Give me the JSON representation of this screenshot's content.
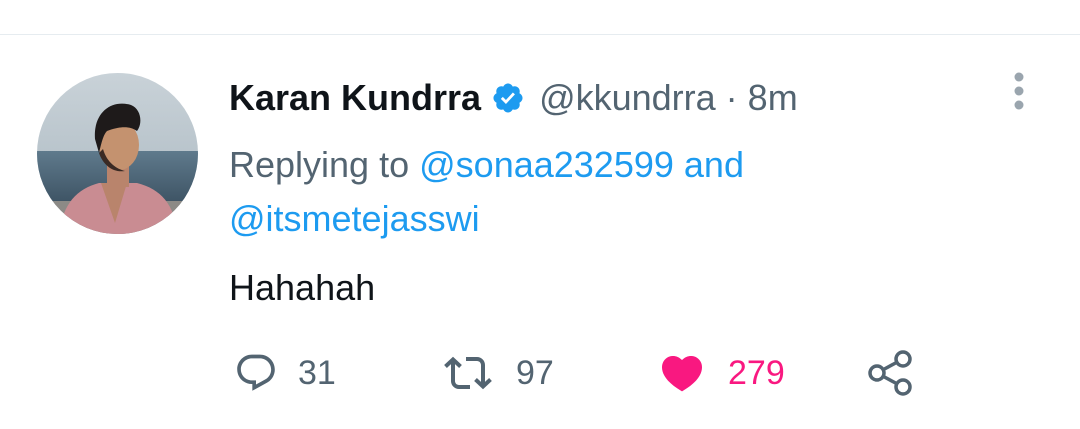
{
  "tweet": {
    "author_name": "Karan Kundrra",
    "verified": true,
    "handle": "@kkundrra",
    "separator": "·",
    "time": "8m",
    "reply_prefix": "Replying to",
    "reply_mention_1": "@sonaa232599",
    "reply_conjunction": "and",
    "reply_mention_2": "@itsmetejasswi",
    "text": "Hahahah"
  },
  "actions": {
    "replies": "31",
    "retweets": "97",
    "likes": "279",
    "liked": true
  },
  "icons": {
    "reply": "reply-icon",
    "retweet": "retweet-icon",
    "like": "heart-icon",
    "share": "share-icon",
    "more": "more-vertical-icon",
    "verified": "verified-badge-icon"
  },
  "colors": {
    "accent": "#1d9bf0",
    "like": "#f91880",
    "secondary_text": "#536471",
    "primary_text": "#0f1419"
  }
}
